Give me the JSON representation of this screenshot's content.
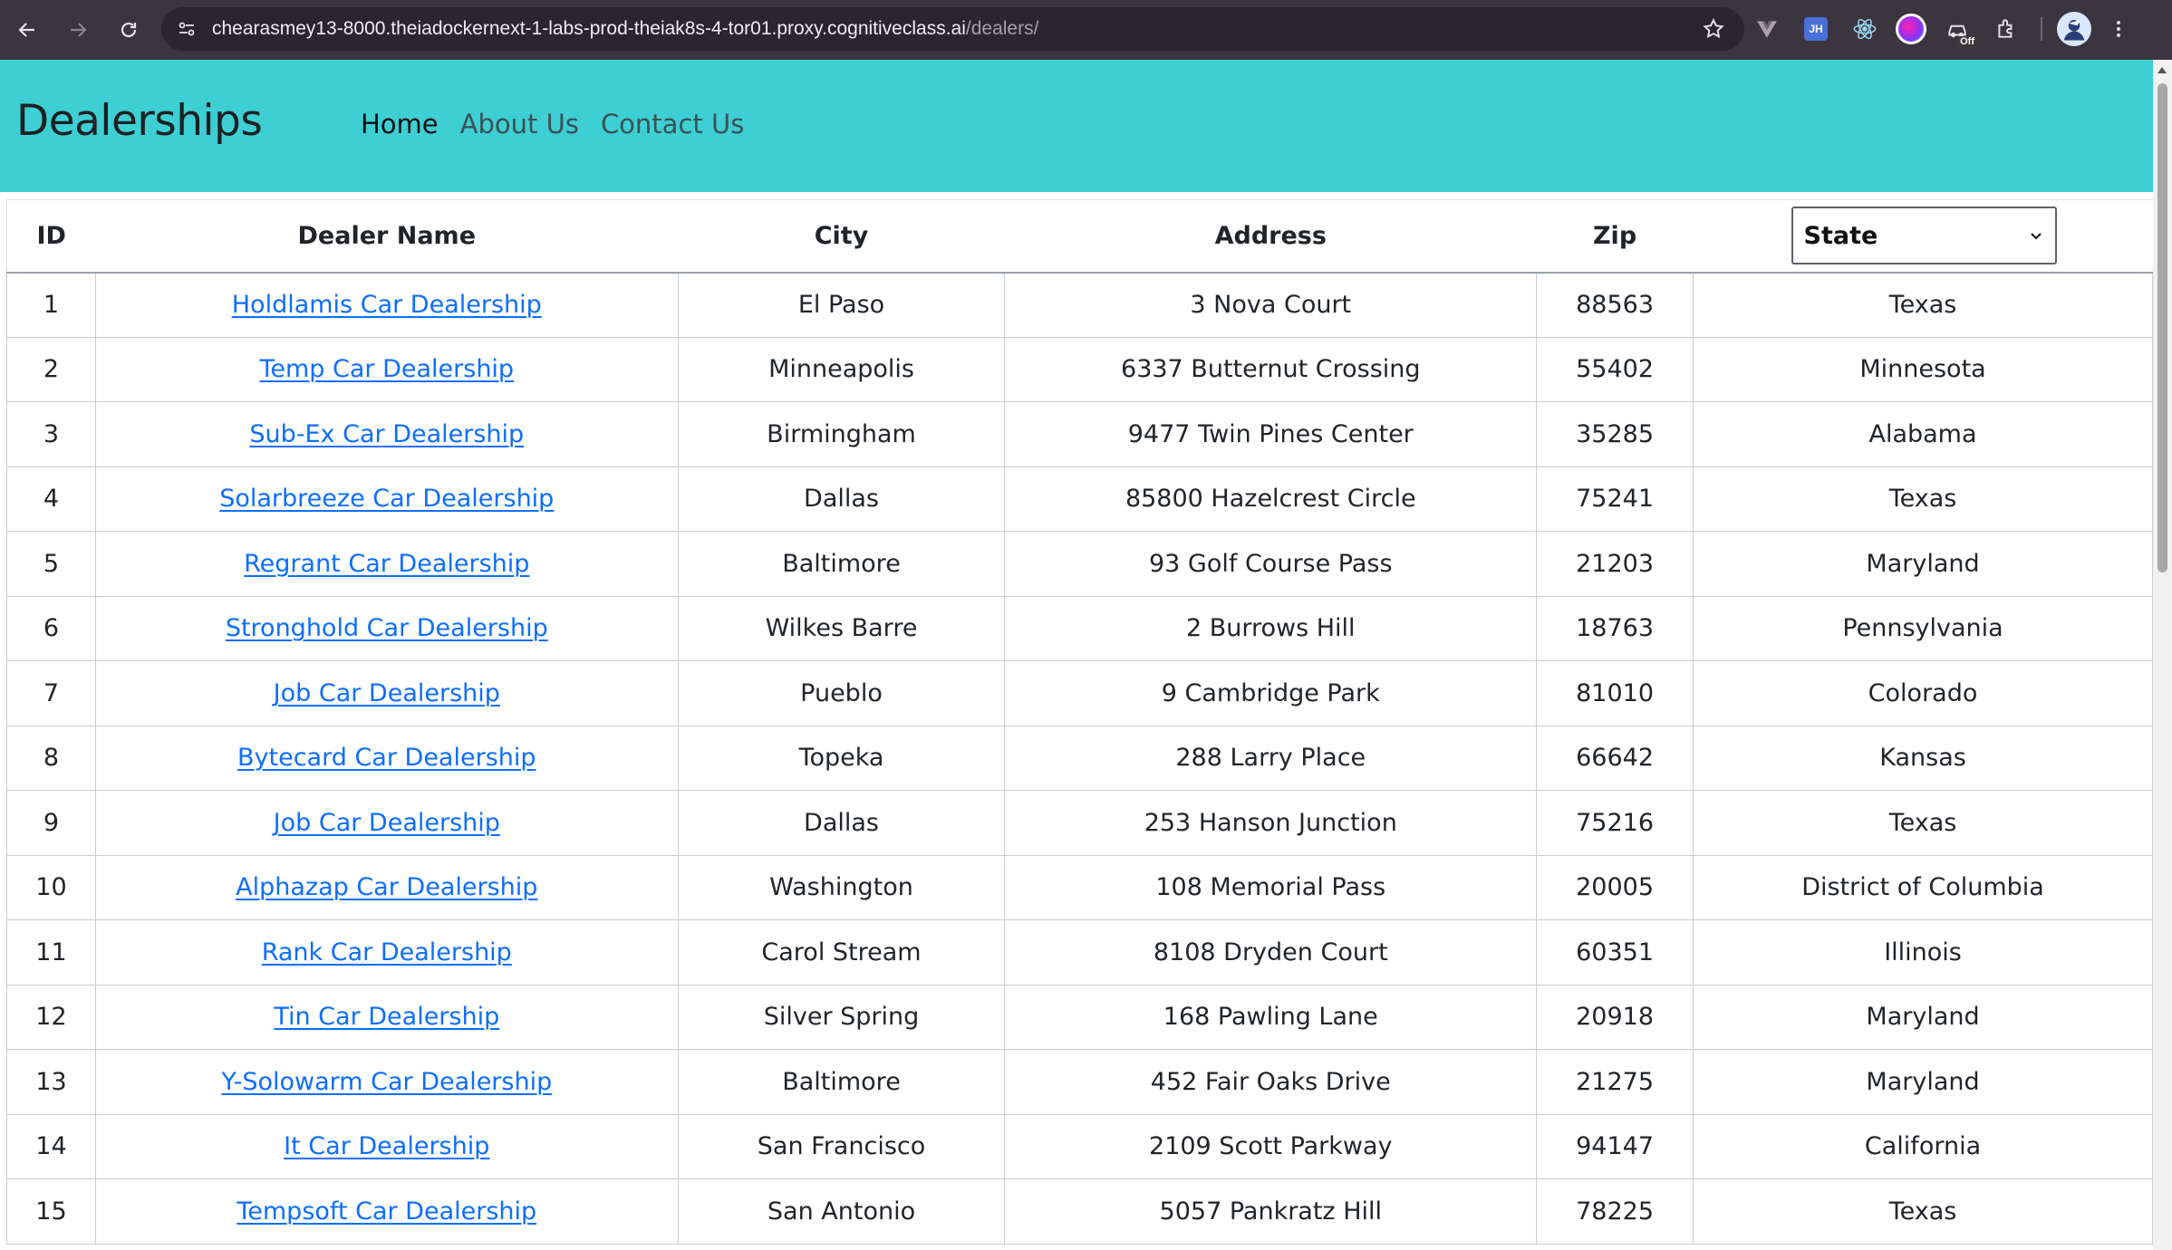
{
  "browser": {
    "url_host": "chearasmey13-8000.theiadockernext-1-labs-prod-theiak8s-4-tor01.proxy.cognitiveclass.ai",
    "url_path": "/dealers/",
    "ext_jh": "JH",
    "ext_off_badge": "Off"
  },
  "navbar": {
    "brand": "Dealerships",
    "links": [
      "Home",
      "About Us",
      "Contact Us"
    ]
  },
  "table": {
    "headers": {
      "id": "ID",
      "name": "Dealer Name",
      "city": "City",
      "address": "Address",
      "zip": "Zip",
      "state_select": "State"
    },
    "rows": [
      {
        "id": "1",
        "name": "Holdlamis Car Dealership",
        "city": "El Paso",
        "address": "3 Nova Court",
        "zip": "88563",
        "state": "Texas"
      },
      {
        "id": "2",
        "name": "Temp Car Dealership",
        "city": "Minneapolis",
        "address": "6337 Butternut Crossing",
        "zip": "55402",
        "state": "Minnesota"
      },
      {
        "id": "3",
        "name": "Sub-Ex Car Dealership",
        "city": "Birmingham",
        "address": "9477 Twin Pines Center",
        "zip": "35285",
        "state": "Alabama"
      },
      {
        "id": "4",
        "name": "Solarbreeze Car Dealership",
        "city": "Dallas",
        "address": "85800 Hazelcrest Circle",
        "zip": "75241",
        "state": "Texas"
      },
      {
        "id": "5",
        "name": "Regrant Car Dealership",
        "city": "Baltimore",
        "address": "93 Golf Course Pass",
        "zip": "21203",
        "state": "Maryland"
      },
      {
        "id": "6",
        "name": "Stronghold Car Dealership",
        "city": "Wilkes Barre",
        "address": "2 Burrows Hill",
        "zip": "18763",
        "state": "Pennsylvania"
      },
      {
        "id": "7",
        "name": "Job Car Dealership",
        "city": "Pueblo",
        "address": "9 Cambridge Park",
        "zip": "81010",
        "state": "Colorado"
      },
      {
        "id": "8",
        "name": "Bytecard Car Dealership",
        "city": "Topeka",
        "address": "288 Larry Place",
        "zip": "66642",
        "state": "Kansas"
      },
      {
        "id": "9",
        "name": "Job Car Dealership",
        "city": "Dallas",
        "address": "253 Hanson Junction",
        "zip": "75216",
        "state": "Texas"
      },
      {
        "id": "10",
        "name": "Alphazap Car Dealership",
        "city": "Washington",
        "address": "108 Memorial Pass",
        "zip": "20005",
        "state": "District of Columbia"
      },
      {
        "id": "11",
        "name": "Rank Car Dealership",
        "city": "Carol Stream",
        "address": "8108 Dryden Court",
        "zip": "60351",
        "state": "Illinois"
      },
      {
        "id": "12",
        "name": "Tin Car Dealership",
        "city": "Silver Spring",
        "address": "168 Pawling Lane",
        "zip": "20918",
        "state": "Maryland"
      },
      {
        "id": "13",
        "name": "Y-Solowarm Car Dealership",
        "city": "Baltimore",
        "address": "452 Fair Oaks Drive",
        "zip": "21275",
        "state": "Maryland"
      },
      {
        "id": "14",
        "name": "It Car Dealership",
        "city": "San Francisco",
        "address": "2109 Scott Parkway",
        "zip": "94147",
        "state": "California"
      },
      {
        "id": "15",
        "name": "Tempsoft Car Dealership",
        "city": "San Antonio",
        "address": "5057 Pankratz Hill",
        "zip": "78225",
        "state": "Texas"
      }
    ]
  },
  "colors": {
    "navbar_bg": "#3dcfd3",
    "link": "#0d6efd",
    "browser_bg": "#3b3540"
  }
}
